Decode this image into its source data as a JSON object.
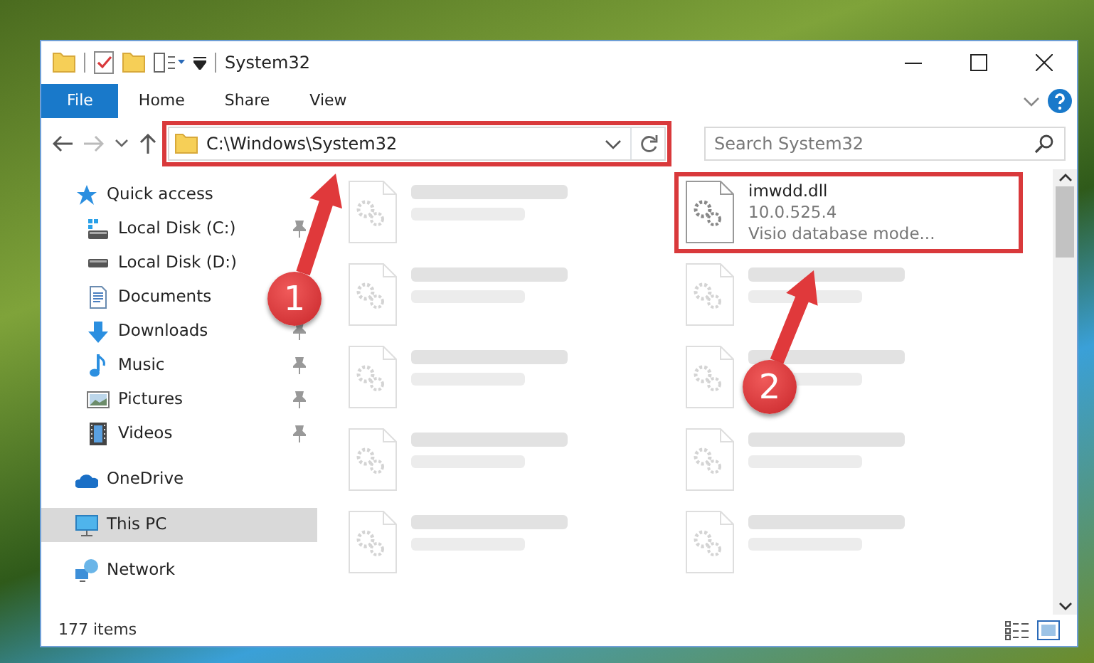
{
  "window": {
    "title": "System32"
  },
  "ribbon_tabs": [
    {
      "label": "File",
      "selected": true
    },
    {
      "label": "Home",
      "selected": false
    },
    {
      "label": "Share",
      "selected": false
    },
    {
      "label": "View",
      "selected": false
    }
  ],
  "address_bar": {
    "path": "C:\\Windows\\System32"
  },
  "search": {
    "placeholder": "Search System32"
  },
  "nav_pane": [
    {
      "kind": "quick",
      "label": "Quick access",
      "selected": false,
      "children": [
        {
          "kind": "disk-c",
          "label": "Local Disk (C:)",
          "pinned": true,
          "selected": false
        },
        {
          "kind": "disk",
          "label": "Local Disk (D:)",
          "pinned": false,
          "selected": false
        },
        {
          "kind": "documents",
          "label": "Documents",
          "pinned": false,
          "selected": false
        },
        {
          "kind": "downloads",
          "label": "Downloads",
          "pinned": true,
          "selected": false
        },
        {
          "kind": "music",
          "label": "Music",
          "pinned": true,
          "selected": false
        },
        {
          "kind": "pictures",
          "label": "Pictures",
          "pinned": true,
          "selected": false
        },
        {
          "kind": "videos",
          "label": "Videos",
          "pinned": true,
          "selected": false
        }
      ]
    },
    {
      "kind": "onedrive",
      "label": "OneDrive",
      "selected": false
    },
    {
      "kind": "pc",
      "label": "This PC",
      "selected": true
    },
    {
      "kind": "network",
      "label": "Network",
      "selected": false
    }
  ],
  "files": [
    {
      "dimmed": true
    },
    {
      "name": "imwdd.dll",
      "lines": [
        "10.0.525.4",
        "Visio database mode..."
      ],
      "dimmed": false
    },
    {
      "dimmed": true
    },
    {
      "dimmed": true
    },
    {
      "dimmed": true
    },
    {
      "dimmed": true
    },
    {
      "dimmed": true
    },
    {
      "dimmed": true
    },
    {
      "dimmed": true
    },
    {
      "dimmed": true
    }
  ],
  "status_bar": {
    "item_count": "177 items"
  },
  "annotations": [
    {
      "label": "1",
      "kind": "address"
    },
    {
      "label": "2",
      "kind": "file"
    }
  ]
}
